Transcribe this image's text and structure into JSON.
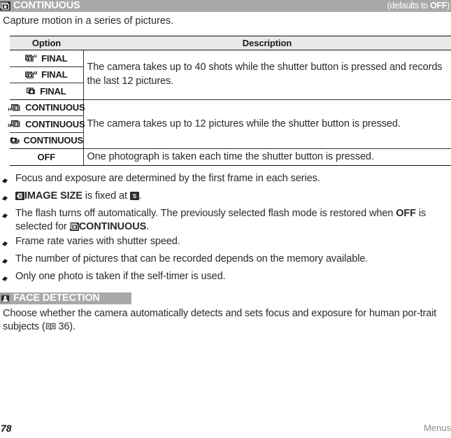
{
  "page": {
    "folio": "78",
    "running_head": "Menus"
  },
  "continuous_section": {
    "icon_name": "continuous-burst-icon",
    "title": "CONTINUOUS",
    "defaults_prefix": "(defaults to ",
    "defaults_value": "OFF",
    "defaults_suffix": ")",
    "intro": "Capture motion in a series of pictures.",
    "table": {
      "headers": [
        "Option",
        "Description"
      ],
      "rows": [
        {
          "icon_name": "final-high-stack-icon",
          "icon_letter": "H",
          "icon_letter_position": "superscript",
          "label": "FINAL",
          "description": "The camera takes up to 40 shots while the shutter button is pressed and records the last 12 pictures.",
          "description_rowspan": 3
        },
        {
          "icon_name": "final-medium-stack-icon",
          "icon_letter": "M",
          "icon_letter_position": "superscript",
          "label": "FINAL"
        },
        {
          "icon_name": "final-stack-icon",
          "icon_letter": "",
          "icon_letter_position": "none",
          "label": "FINAL"
        },
        {
          "icon_name": "continuous-high-stack-icon",
          "icon_letter": "H",
          "icon_letter_position": "subscript",
          "label": "CONTINUOUS",
          "description": "The camera takes up to 12 pictures while the shutter button is pressed.",
          "description_rowspan": 3
        },
        {
          "icon_name": "continuous-medium-stack-icon",
          "icon_letter": "M",
          "icon_letter_position": "subscript",
          "label": "CONTINUOUS"
        },
        {
          "icon_name": "continuous-stack-icon",
          "icon_letter": "",
          "icon_letter_position": "none",
          "label": "CONTINUOUS"
        },
        {
          "icon_name": "",
          "icon_letter": "",
          "icon_letter_position": "none",
          "label": "OFF",
          "description": "One photograph is taken each time the shutter button is pressed.",
          "description_rowspan": 1
        }
      ]
    },
    "notes": [
      {
        "bullet_icon": "diamond-bullet-icon",
        "text_before": "Focus and exposure are determined by the first frame in each series.",
        "inline_icon": "",
        "bold_run": "",
        "text_mid": "",
        "inline_icon_2": "",
        "text_after": ""
      },
      {
        "bullet_icon": "diamond-bullet-icon",
        "inline_icon": "image-size-icon",
        "bold_run": "IMAGE SIZE",
        "text_mid": " is fixed at ",
        "inline_icon_2": "size-s-icon",
        "text_after": "."
      },
      {
        "bullet_icon": "diamond-bullet-icon",
        "text_before": "The flash turns off automatically. The previously selected flash mode is restored when ",
        "bold_run": "OFF",
        "text_mid": " is selected for ",
        "inline_icon_2": "continuous-burst-icon",
        "bold_run_2": "CONTINUOUS",
        "text_after": "."
      },
      {
        "bullet_icon": "diamond-bullet-icon",
        "text_before": "Frame rate varies with shutter speed."
      },
      {
        "bullet_icon": "diamond-bullet-icon",
        "text_before": "The number of pictures that can be recorded depends on the memory available."
      },
      {
        "bullet_icon": "diamond-bullet-icon",
        "text_before": "Only one photo is taken if the self-timer is used."
      }
    ]
  },
  "face_section": {
    "icon_name": "face-detection-icon",
    "title": "FACE DETECTION",
    "body_before": "Choose whether the camera automatically detects and sets focus and exposure for human por-trait subjects (",
    "body_line1": "Choose whether the camera automatically detects and sets focus and exposure for human por-",
    "body_line2_before": "trait subjects (",
    "page_ref_icon": "book-reference-icon",
    "page_ref": "36",
    "body_line2_after": ")."
  },
  "colors": {
    "section_bar": "#a9a9a9",
    "badge": "#2b2b2b",
    "table_header_bg": "#e9e9e9",
    "rule": "#111111",
    "body_text": "#2a2a2a",
    "running_head": "#8c8c8c"
  }
}
